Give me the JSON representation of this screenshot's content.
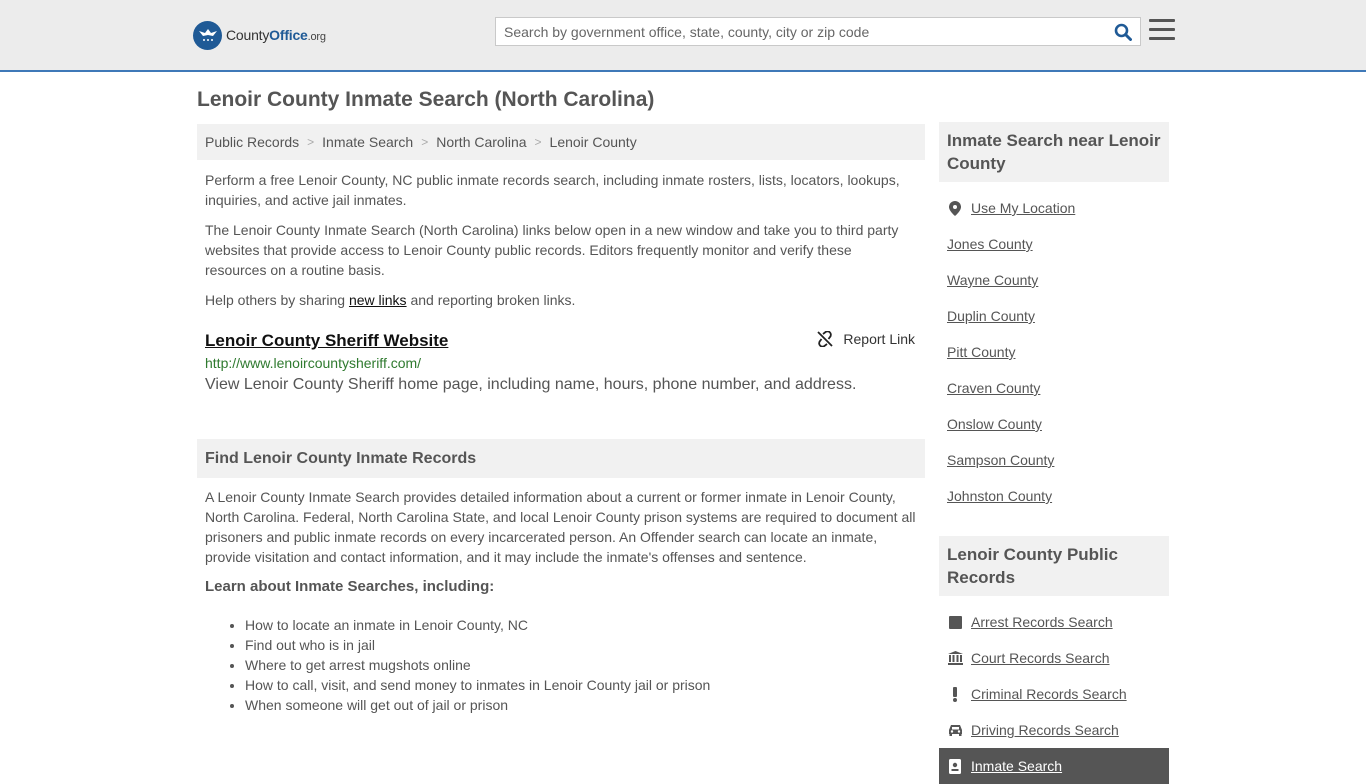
{
  "header": {
    "logo_prefix": "County",
    "logo_bold": "Office",
    "logo_tld": ".org",
    "search_placeholder": "Search by government office, state, county, city or zip code"
  },
  "page": {
    "title": "Lenoir County Inmate Search (North Carolina)"
  },
  "breadcrumb": [
    "Public Records",
    "Inmate Search",
    "North Carolina",
    "Lenoir County"
  ],
  "intro": {
    "p1": "Perform a free Lenoir County, NC public inmate records search, including inmate rosters, lists, locators, lookups, inquiries, and active jail inmates.",
    "p2": "The Lenoir County Inmate Search (North Carolina) links below open in a new window and take you to third party websites that provide access to Lenoir County public records. Editors frequently monitor and verify these resources on a routine basis.",
    "p3_before": "Help others by sharing ",
    "p3_link": "new links",
    "p3_after": " and reporting broken links."
  },
  "link": {
    "title": "Lenoir County Sheriff Website",
    "report_label": "Report Link",
    "url": "http://www.lenoircountysheriff.com/",
    "description": "View Lenoir County Sheriff home page, including name, hours, phone number, and address."
  },
  "records": {
    "heading": "Find Lenoir County Inmate Records",
    "paragraph": "A Lenoir County Inmate Search provides detailed information about a current or former inmate in Lenoir County, North Carolina. Federal, North Carolina State, and local Lenoir County prison systems are required to document all prisoners and public inmate records on every incarcerated person. An Offender search can locate an inmate, provide visitation and contact information, and it may include the inmate's offenses and sentence.",
    "learn_heading": "Learn about Inmate Searches, including:",
    "bullets": [
      "How to locate an inmate in Lenoir County, NC",
      "Find out who is in jail",
      "Where to get arrest mugshots online",
      "How to call, visit, and send money to inmates in Lenoir County jail or prison",
      "When someone will get out of jail or prison"
    ]
  },
  "sidebar": {
    "near_heading": "Inmate Search near Lenoir County",
    "near_items": [
      {
        "label": "Use My Location",
        "icon": "map-marker-icon"
      },
      {
        "label": "Jones County"
      },
      {
        "label": "Wayne County"
      },
      {
        "label": "Duplin County"
      },
      {
        "label": "Pitt County"
      },
      {
        "label": "Craven County"
      },
      {
        "label": "Onslow County"
      },
      {
        "label": "Sampson County"
      },
      {
        "label": "Johnston County"
      }
    ],
    "records_heading": "Lenoir County Public Records",
    "records_items": [
      {
        "label": "Arrest Records Search",
        "icon": "square-icon"
      },
      {
        "label": "Court Records Search",
        "icon": "courthouse-icon"
      },
      {
        "label": "Criminal Records Search",
        "icon": "exclamation-icon"
      },
      {
        "label": "Driving Records Search",
        "icon": "car-icon"
      },
      {
        "label": "Inmate Search",
        "icon": "id-badge-icon"
      }
    ]
  },
  "colors": {
    "brand": "#1f5a96",
    "header_border": "#3f79b8",
    "url_green": "#2f7a2f",
    "panel_bg": "#f1f1f1"
  }
}
